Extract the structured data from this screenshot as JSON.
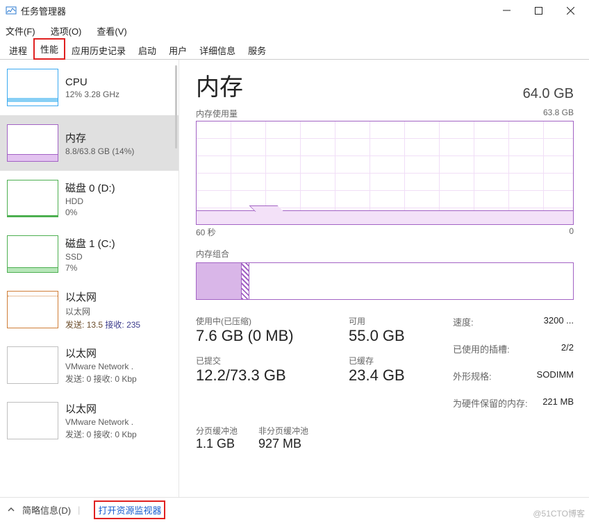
{
  "titlebar": {
    "title": "任务管理器"
  },
  "menu": {
    "file": "文件(F)",
    "options": "选项(O)",
    "view": "查看(V)"
  },
  "tabs": {
    "processes": "进程",
    "performance": "性能",
    "app_history": "应用历史记录",
    "startup": "启动",
    "users": "用户",
    "details": "详细信息",
    "services": "服务"
  },
  "sidebar": {
    "cpu": {
      "title": "CPU",
      "sub": "12% 3.28 GHz"
    },
    "mem": {
      "title": "内存",
      "sub": "8.8/63.8 GB (14%)"
    },
    "disk0": {
      "title": "磁盘 0 (D:)",
      "sub1": "HDD",
      "sub2": "0%"
    },
    "disk1": {
      "title": "磁盘 1 (C:)",
      "sub1": "SSD",
      "sub2": "7%"
    },
    "eth0": {
      "title": "以太网",
      "sub1": "以太网",
      "tx_lab": "发送:",
      "tx": "13.5",
      "rx_lab": "接收:",
      "rx": "235"
    },
    "eth1": {
      "title": "以太网",
      "sub1": "VMware Network .",
      "line": "发送: 0 接收: 0 Kbp"
    },
    "eth2": {
      "title": "以太网",
      "sub1": "VMware Network .",
      "line": "发送: 0 接收: 0 Kbp"
    }
  },
  "content": {
    "title": "内存",
    "total": "64.0 GB",
    "usage_label": "内存使用量",
    "usage_max": "63.8 GB",
    "axis_left": "60 秒",
    "axis_right": "0",
    "comp_label": "内存组合",
    "metrics": {
      "inuse_lab": "使用中(已压缩)",
      "inuse": "7.6 GB (0 MB)",
      "avail_lab": "可用",
      "avail": "55.0 GB",
      "commit_lab": "已提交",
      "commit": "12.2/73.3 GB",
      "cached_lab": "已缓存",
      "cached": "23.4 GB",
      "paged_lab": "分页缓冲池",
      "paged": "1.1 GB",
      "nonpaged_lab": "非分页缓冲池",
      "nonpaged": "927 MB"
    },
    "spec": {
      "speed_k": "速度:",
      "speed_v": "3200 ...",
      "slots_k": "已使用的插槽:",
      "slots_v": "2/2",
      "form_k": "外形规格:",
      "form_v": "SODIMM",
      "hw_k": "为硬件保留的内存:",
      "hw_v": "221 MB"
    }
  },
  "footer": {
    "brief": "简略信息(D)",
    "open_resmon": "打开资源监视器"
  },
  "watermark": "@51CTO博客",
  "chart_data": {
    "type": "line",
    "title": "内存使用量",
    "ylim": [
      0,
      63.8
    ],
    "y_unit": "GB",
    "xlim": [
      60,
      0
    ],
    "x_unit": "秒",
    "series": [
      {
        "name": "内存使用量",
        "approx_value": 8.8
      }
    ],
    "composition_stacked_bar": {
      "total": 63.8,
      "segments": [
        {
          "name": "使用中",
          "approx_gb": 7.6
        },
        {
          "name": "已压缩",
          "approx_gb": 0
        },
        {
          "name": "可用/缓存",
          "approx_gb": 56.2
        }
      ]
    }
  }
}
